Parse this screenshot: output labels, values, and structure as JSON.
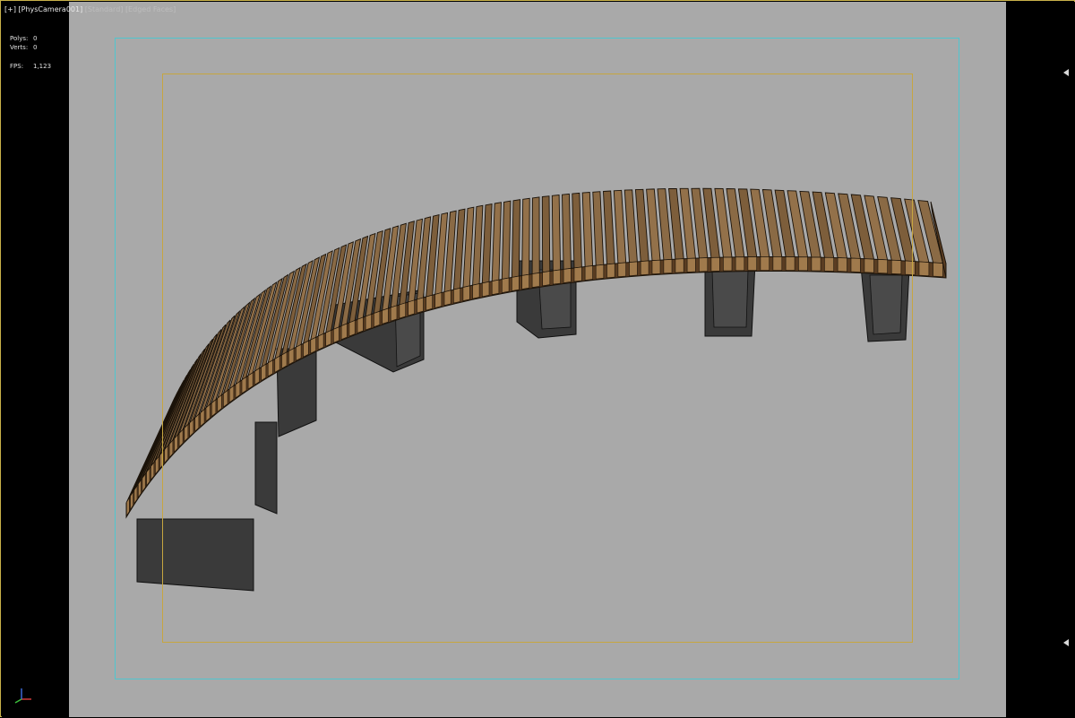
{
  "viewport": {
    "menu_label": "[+]",
    "camera_label": "[PhysCamera001]",
    "shading_label": "[Standard]",
    "mode_label": "[Edged Faces]"
  },
  "stats": {
    "polys_label": "Polys:",
    "polys_value": "0",
    "verts_label": "Verts:",
    "verts_value": "0",
    "fps_label": "FPS:",
    "fps_value": "1,123"
  },
  "colors": {
    "background": "#a9a9a9",
    "safe_frame_outer": "#4fc6cf",
    "safe_frame_inner": "#c6a640",
    "wood_top": "#8a6a45",
    "wood_side": "#5a3d22",
    "leg": "#3a3a3a"
  },
  "icons": {
    "axis_gizmo": "xyz-axis-gizmo-icon",
    "side_arrows": "collapse-arrow-icon"
  }
}
